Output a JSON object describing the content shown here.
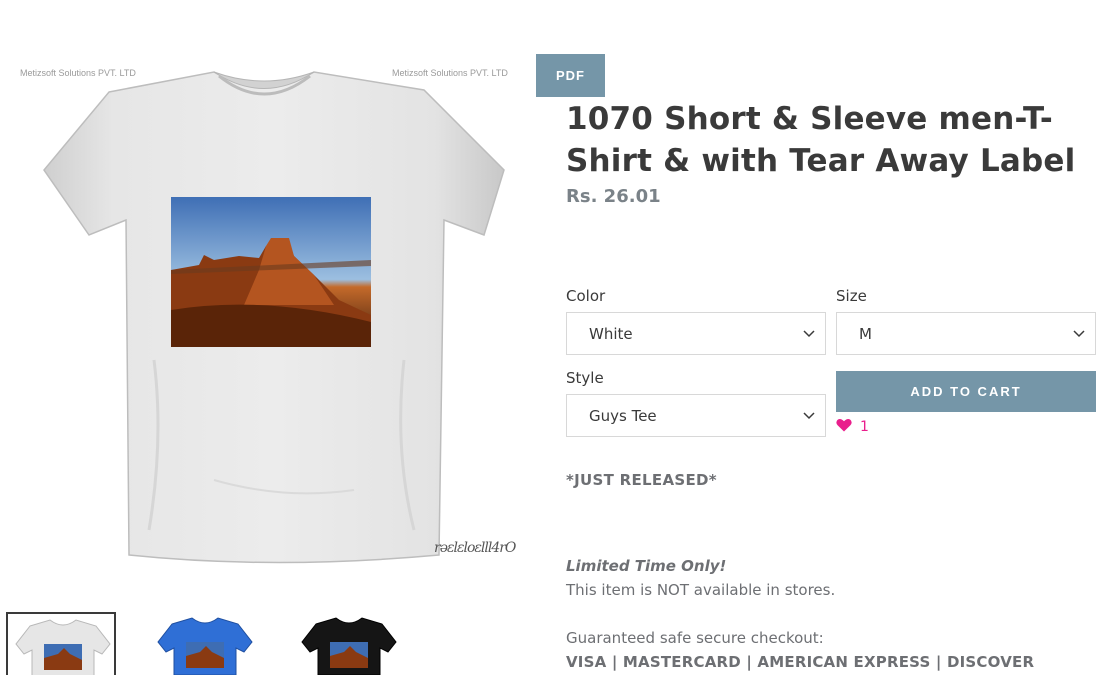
{
  "image": {
    "watermark_left": "Metizsoft Solutions PVT. LTD",
    "watermark_right": "Metizsoft Solutions PVT. LTD"
  },
  "pdf_label": "PDF",
  "product": {
    "title": "1070 Short & Sleeve men-T-Shirt & with Tear Away Label",
    "price": "Rs. 26.01"
  },
  "options": {
    "color_label": "Color",
    "color_value": "White",
    "size_label": "Size",
    "size_value": "M",
    "style_label": "Style",
    "style_value": "Guys Tee"
  },
  "add_to_cart_label": "ADD TO CART",
  "likes": {
    "count": "1"
  },
  "description": {
    "released": "*JUST RELEASED*",
    "limited": "Limited Time Only!",
    "not_available": "This item is NOT available in stores.",
    "guaranteed": "Guaranteed safe secure checkout:",
    "cards": "VISA | MASTERCARD | AMERICAN EXPRESS | DISCOVER"
  },
  "thumbnails": [
    {
      "shirt_color": "#e8e8e8",
      "selected": true
    },
    {
      "shirt_color": "#2f6fd6",
      "selected": false
    },
    {
      "shirt_color": "#151515",
      "selected": false
    }
  ],
  "colors": {
    "accent": "#7596a8",
    "heart": "#e91e8c",
    "title": "#3a3a3a",
    "muted": "#6d6f73"
  },
  "icons": {
    "chevron": "chevron-down-icon",
    "heart": "heart-icon"
  }
}
